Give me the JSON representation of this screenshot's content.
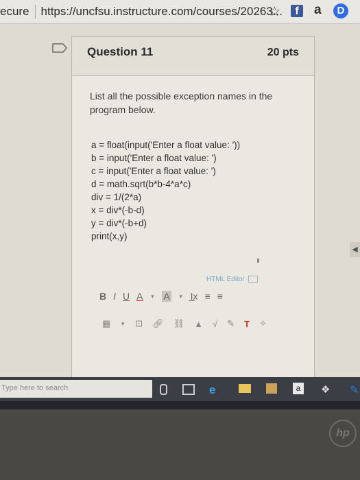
{
  "browser": {
    "secure_label": "ecure",
    "url": "https://uncfsu.instructure.com/courses/20263...",
    "icons": [
      "star-icon",
      "facebook-icon",
      "amazon-icon",
      "d-extension-icon"
    ],
    "amazon_glyph": "a",
    "d_glyph": "D",
    "fb_glyph": "f"
  },
  "question": {
    "title": "Question 11",
    "points": "20 pts",
    "prompt": "List all the possible exception names in the program below.",
    "code": [
      "a = float(input('Enter a float value: '))",
      "b = input('Enter a float value: ')",
      "c = input('Enter a float value: ')",
      "d = math.sqrt(b*b-4*a*c)",
      "div = 1/(2*a)",
      "x = div*(-b-d)",
      "y = div*(-b+d)",
      "print(x,y)"
    ]
  },
  "editor": {
    "label": "HTML Editor",
    "toolbar_row1": {
      "bold": "B",
      "italic": "I",
      "underline": "U",
      "font_color": "A",
      "highlight": "A",
      "clear_format": "I̲x",
      "align_left": "≡",
      "align_center": "≡"
    },
    "toolbar_row2_icons": [
      "table-icon",
      "media-icon",
      "link-icon",
      "unlink-icon",
      "image-icon",
      "math-icon",
      "pin-icon",
      "text-icon",
      "rce-icon"
    ],
    "text_glyph": "T"
  },
  "taskbar": {
    "search_placeholder": "Type here to search",
    "amazon_glyph": "a"
  },
  "brand": {
    "hp_logo": "hp"
  }
}
